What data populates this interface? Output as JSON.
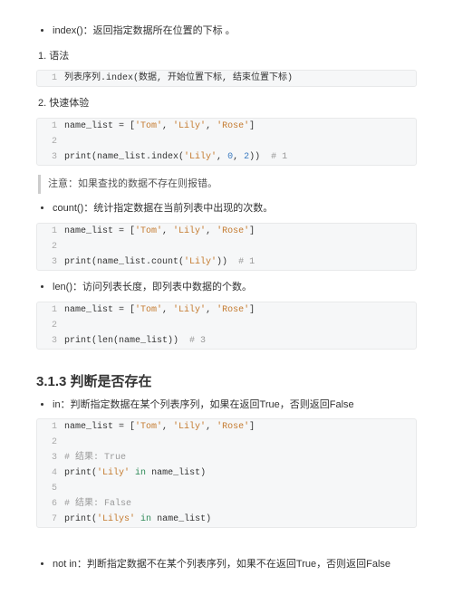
{
  "bullets": {
    "index_desc": "index()：返回指定数据所在位置的下标 。",
    "count_desc": "count()：统计指定数据在当前列表中出现的次数。",
    "len_desc": "len()：访问列表长度，即列表中数据的个数。",
    "in_desc": "in：判断指定数据在某个列表序列，如果在返回True，否则返回False",
    "notin_desc": "not in：判断指定数据不在某个列表序列，如果不在返回True，否则返回False"
  },
  "steps": {
    "syntax_label": "1. 语法",
    "quick_label": "2. 快速体验"
  },
  "note_text": "注意：如果查找的数据不存在则报错。",
  "section_title": "3.1.3 判断是否存在",
  "code": {
    "syntax": {
      "l1": "列表序列.index(数据, 开始位置下标, 结束位置下标)"
    },
    "index": {
      "l1_a": "name_list = [",
      "l1_s1": "'Tom'",
      "l1_c1": ", ",
      "l1_s2": "'Lily'",
      "l1_c2": ", ",
      "l1_s3": "'Rose'",
      "l1_b": "]",
      "l3_a": "print(name_list.index(",
      "l3_s": "'Lily'",
      "l3_c1": ", ",
      "l3_n1": "0",
      "l3_c2": ", ",
      "l3_n2": "2",
      "l3_b": "))  ",
      "l3_cmt": "# 1"
    },
    "count": {
      "l1_a": "name_list = [",
      "l1_s1": "'Tom'",
      "l1_c1": ", ",
      "l1_s2": "'Lily'",
      "l1_c2": ", ",
      "l1_s3": "'Rose'",
      "l1_b": "]",
      "l3_a": "print(name_list.count(",
      "l3_s": "'Lily'",
      "l3_b": "))  ",
      "l3_cmt": "# 1"
    },
    "len": {
      "l1_a": "name_list = [",
      "l1_s1": "'Tom'",
      "l1_c1": ", ",
      "l1_s2": "'Lily'",
      "l1_c2": ", ",
      "l1_s3": "'Rose'",
      "l1_b": "]",
      "l3_a": "print(len(name_list))  ",
      "l3_cmt": "# 3"
    },
    "in": {
      "l1_a": "name_list = [",
      "l1_s1": "'Tom'",
      "l1_c1": ", ",
      "l1_s2": "'Lily'",
      "l1_c2": ", ",
      "l1_s3": "'Rose'",
      "l1_b": "]",
      "l3_cmt": "# 结果: True",
      "l4_a": "print(",
      "l4_s": "'Lily'",
      "l4_b": " ",
      "l4_kw": "in",
      "l4_c": " name_list)",
      "l6_cmt": "# 结果: False",
      "l7_a": "print(",
      "l7_s": "'Lilys'",
      "l7_b": " ",
      "l7_kw": "in",
      "l7_c": " name_list)"
    }
  },
  "ln": {
    "n1": "1",
    "n2": "2",
    "n3": "3",
    "n4": "4",
    "n5": "5",
    "n6": "6",
    "n7": "7"
  }
}
